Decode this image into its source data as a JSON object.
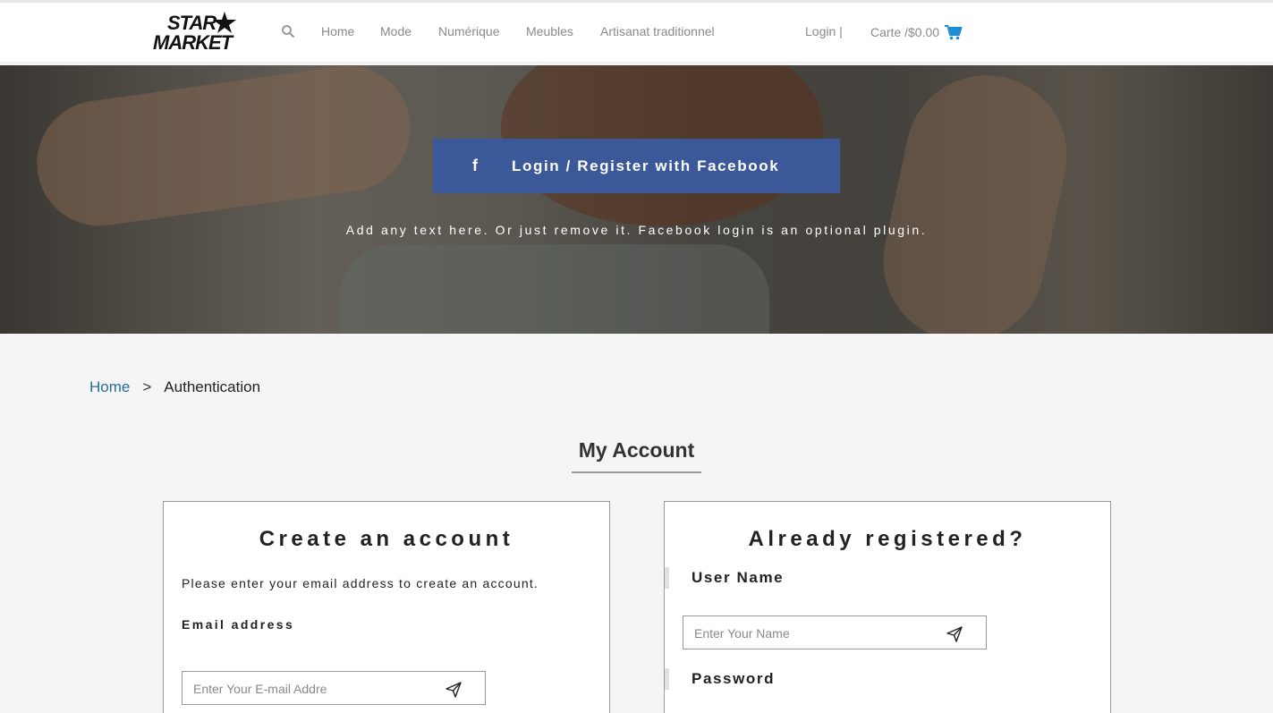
{
  "header": {
    "logo": {
      "line1": "STAR",
      "line2": "MARKET"
    },
    "nav": [
      "Home",
      "Mode",
      "Numérique",
      "Meubles",
      "Artisanat traditionnel"
    ],
    "login_label": "Login |",
    "cart_label": "Carte /$0.00",
    "icons": {
      "search": "search-icon",
      "cart": "cart-icon"
    }
  },
  "hero": {
    "facebook_button": {
      "icon": "f",
      "label": "Login / Register with Facebook"
    },
    "note": "Add any text here. Or just remove it. Facebook login is an optional plugin."
  },
  "breadcrumb": {
    "home": "Home",
    "separator": ">",
    "current": "Authentication"
  },
  "page_title": "My Account",
  "create_account": {
    "title": "Create an account",
    "intro": "Please enter your email address to create an account.",
    "email_label": "Email address",
    "email_placeholder": "Enter Your E-mail Addre",
    "email_value": ""
  },
  "login": {
    "title": "Already registered?",
    "username_label": "User Name",
    "username_placeholder": "Enter Your Name",
    "username_value": "",
    "password_label": "Password"
  },
  "colors": {
    "facebook": "#3b5998",
    "link": "#2a6aa3",
    "cart_icon": "#1e8fd3"
  }
}
